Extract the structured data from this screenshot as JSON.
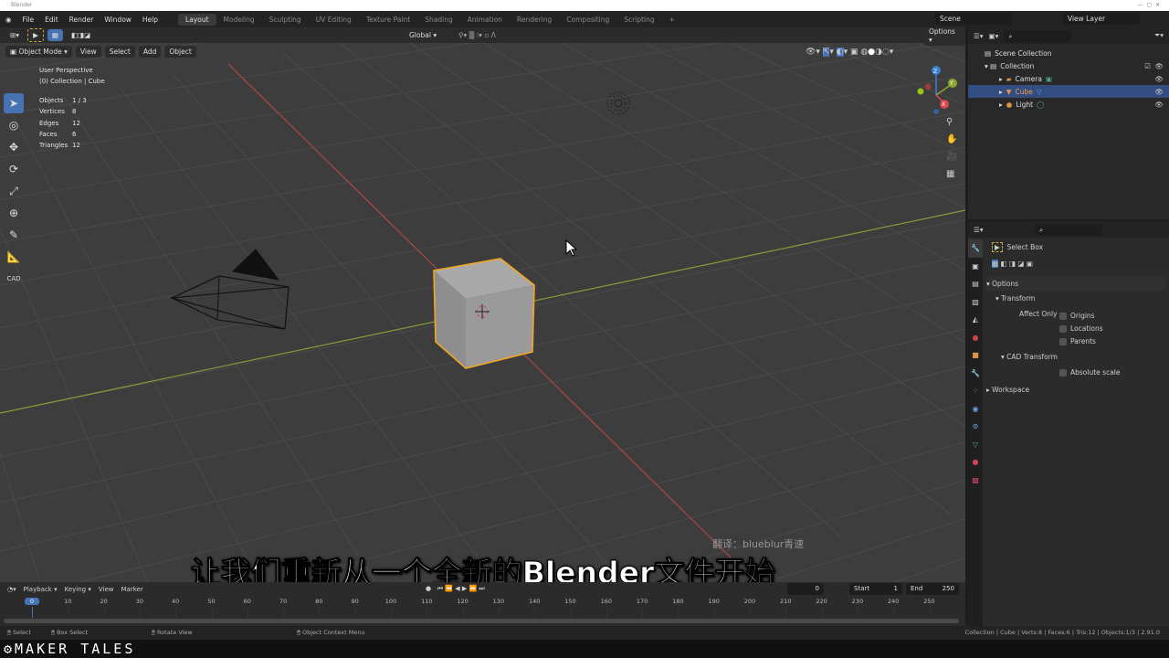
{
  "window": {
    "title": "Blender"
  },
  "menu": [
    "File",
    "Edit",
    "Render",
    "Window",
    "Help"
  ],
  "workspaces": [
    "Layout",
    "Modeling",
    "Sculpting",
    "UV Editing",
    "Texture Paint",
    "Shading",
    "Animation",
    "Rendering",
    "Compositing",
    "Scripting",
    "+"
  ],
  "scene": {
    "label": "Scene",
    "view_layer": "View Layer"
  },
  "viewport": {
    "mode": "Object Mode",
    "menus": [
      "View",
      "Select",
      "Add",
      "Object"
    ],
    "orientation": "Global",
    "options": "Options",
    "overlay": {
      "title": "User Perspective",
      "context": "(0) Collection | Cube",
      "stats": [
        {
          "k": "Objects",
          "v": "1 / 3"
        },
        {
          "k": "Vertices",
          "v": "8"
        },
        {
          "k": "Edges",
          "v": "12"
        },
        {
          "k": "Faces",
          "v": "6"
        },
        {
          "k": "Triangles",
          "v": "12"
        }
      ]
    },
    "tools": [
      "cursor",
      "move",
      "rotate",
      "scale",
      "transform",
      "annotate",
      "measure",
      "CAD"
    ],
    "gizmo": {
      "z": "Z",
      "y": "Y",
      "x": "X"
    }
  },
  "outliner": {
    "root": "Scene Collection",
    "collection": "Collection",
    "items": [
      {
        "name": "Camera",
        "selected": false
      },
      {
        "name": "Cube",
        "selected": true
      },
      {
        "name": "Light",
        "selected": false
      }
    ]
  },
  "properties": {
    "tool": "Select Box",
    "options": "Options",
    "transform": "Transform",
    "affect_only": "Affect Only",
    "checks": [
      "Origins",
      "Locations",
      "Parents"
    ],
    "cad_transform": "CAD Transform",
    "absolute_scale": "Absolute scale",
    "workspace": "Workspace"
  },
  "timeline": {
    "menus": [
      "Playback",
      "Keying",
      "View",
      "Marker"
    ],
    "current": "0",
    "start_label": "Start",
    "start": "1",
    "end_label": "End",
    "end": "250",
    "ticks": [
      "0",
      "10",
      "20",
      "30",
      "40",
      "50",
      "60",
      "70",
      "80",
      "90",
      "100",
      "110",
      "120",
      "130",
      "140",
      "150",
      "160",
      "170",
      "180",
      "190",
      "200",
      "210",
      "220",
      "230",
      "240",
      "250"
    ]
  },
  "status": {
    "left": [
      "Select",
      "Box Select",
      "Rotate View",
      "Object Context Menu"
    ],
    "right": "Collection | Cube | Verts:8 | Faces:6 | Tris:12 | Objects:1/3 | 2.91.0"
  },
  "subtitle": "让我们重新从一个全新的Blender文件开始",
  "watermark": "翻译：blueblur青速",
  "brand": "MAKER TALES",
  "colors": {
    "accent": "#4772b3",
    "selection": "#f5a623",
    "x_axis": "#c84b4b",
    "y_axis": "#8fa23a"
  }
}
